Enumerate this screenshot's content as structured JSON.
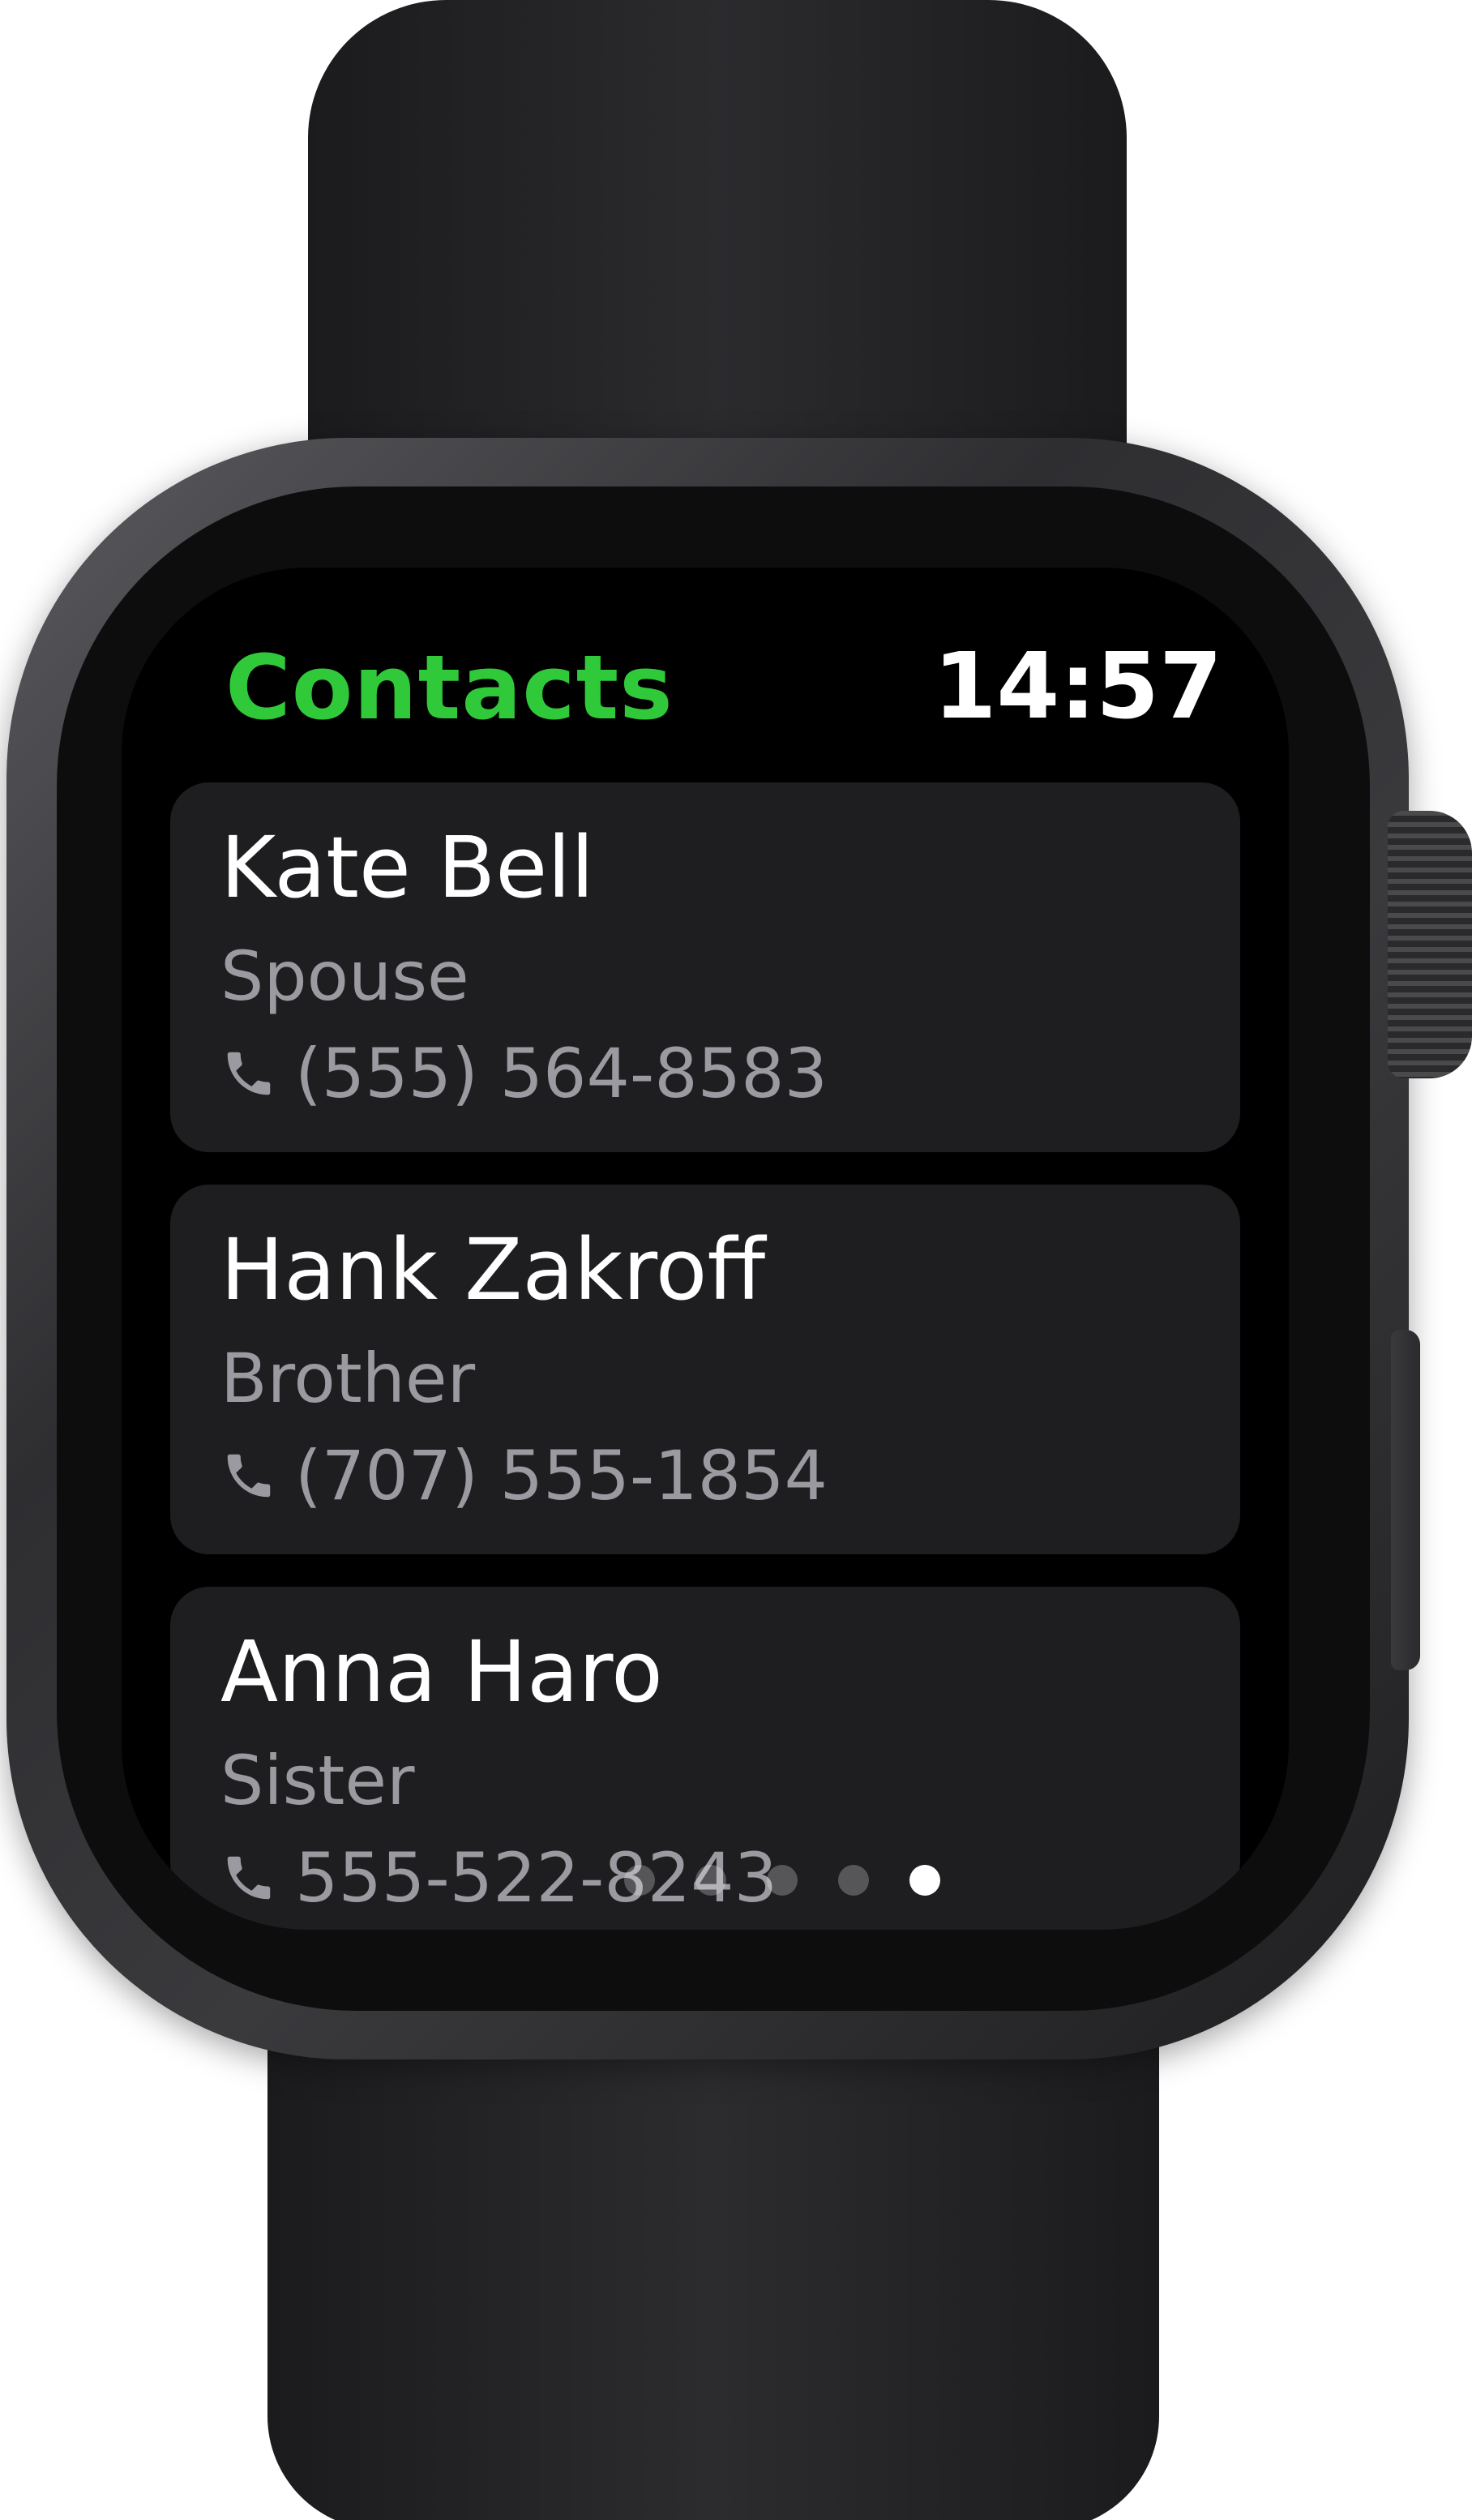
{
  "app": {
    "title": "Contacts",
    "time": "14:57",
    "accent_color": "#30c93a"
  },
  "contacts": [
    {
      "name": "Kate Bell",
      "relation": "Spouse",
      "phone": "(555) 564-8583",
      "icon": "phone-icon"
    },
    {
      "name": "Hank Zakroff",
      "relation": "Brother",
      "phone": "(707) 555-1854",
      "icon": "phone-icon"
    },
    {
      "name": "Anna Haro",
      "relation": "Sister",
      "phone": "555-522-8243",
      "icon": "phone-icon"
    }
  ],
  "page_indicator": {
    "count": 5,
    "active_index": 4
  }
}
